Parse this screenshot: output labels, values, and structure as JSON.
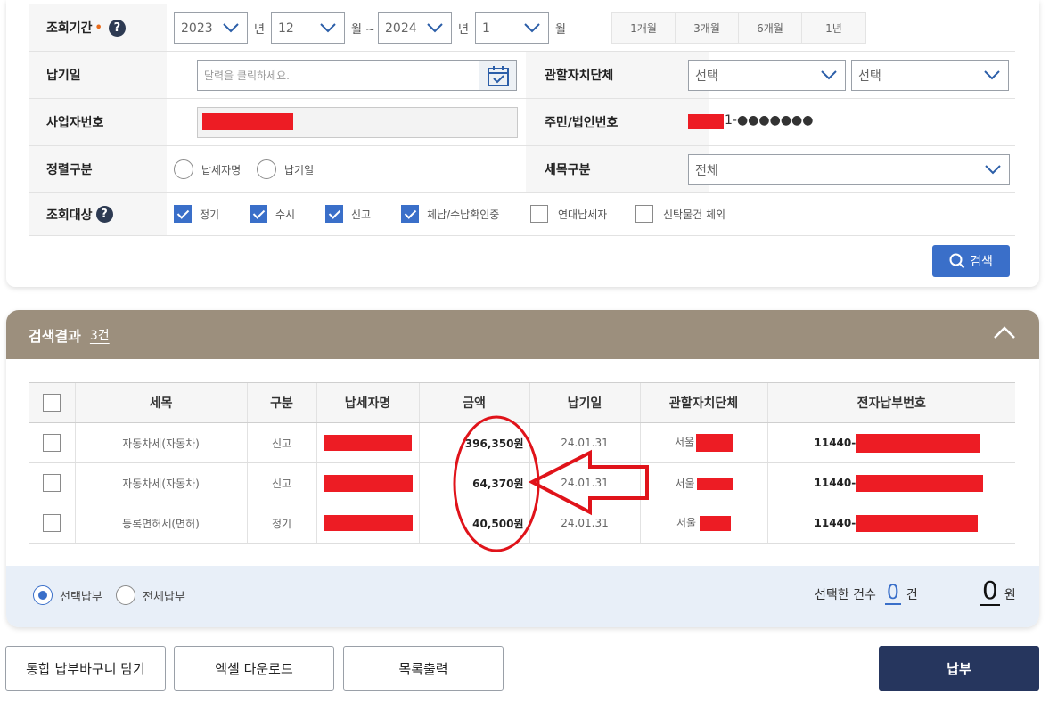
{
  "form": {
    "period": {
      "label": "조회기간",
      "required_mark": "•",
      "help": "?",
      "from_year": "2023",
      "year_unit": "년",
      "from_month": "12",
      "month_sep": "월 ~",
      "to_year": "2024",
      "to_month": "1",
      "month_unit": "월",
      "quick_buttons": [
        "1개월",
        "3개월",
        "6개월",
        "1년"
      ]
    },
    "due_date": {
      "label": "납기일",
      "placeholder": "달력을 클릭하세요."
    },
    "jurisdiction": {
      "label": "관할자치단체",
      "select1": "선택",
      "select2": "선택"
    },
    "business_no": {
      "label": "사업자번호"
    },
    "resident_no": {
      "label": "주민/법인번호",
      "masked_suffix": "1-●●●●●●●"
    },
    "sort": {
      "label": "정렬구분",
      "options": [
        "납세자명",
        "납기일"
      ]
    },
    "tax_type": {
      "label": "세목구분",
      "value": "전체"
    },
    "target": {
      "label": "조회대상",
      "help": "?",
      "options": [
        {
          "label": "정기",
          "checked": true
        },
        {
          "label": "수시",
          "checked": true
        },
        {
          "label": "신고",
          "checked": true
        },
        {
          "label": "체납/수납확인중",
          "checked": true
        },
        {
          "label": "연대납세자",
          "checked": false
        },
        {
          "label": "신탁물건 체외",
          "checked": false
        }
      ]
    },
    "search_button": "검색"
  },
  "results": {
    "title": "검색결과",
    "count": "3건",
    "columns": [
      "세목",
      "구분",
      "납세자명",
      "금액",
      "납기일",
      "관할자치단체",
      "전자납부번호"
    ],
    "rows": [
      {
        "tax": "자동차세(자동차)",
        "type": "신고",
        "amount": "396,350원",
        "due": "24.01.31",
        "region": "서울",
        "epay_prefix": "11440-"
      },
      {
        "tax": "자동차세(자동차)",
        "type": "신고",
        "amount": "64,370원",
        "due": "24.01.31",
        "region": "서울",
        "epay_prefix": "11440-"
      },
      {
        "tax": "등록면허세(면허)",
        "type": "정기",
        "amount": "40,500원",
        "due": "24.01.31",
        "region": "서울",
        "epay_prefix": "11440-"
      }
    ],
    "pay_mode": {
      "selected": "선택납부",
      "all": "전체납부"
    },
    "selected_count_label": "선택한 건수",
    "selected_count": "0",
    "count_unit": "건",
    "selected_amount": "0",
    "amount_unit": "원"
  },
  "actions": {
    "cart": "통합 납부바구니 담기",
    "excel": "엑셀 다운로드",
    "print": "목록출력",
    "pay": "납부"
  },
  "colors": {
    "accent": "#3a6fc9",
    "header_bg": "#9c8f7d",
    "pay_button": "#26365e",
    "redaction": "#ed1c24",
    "annotation": "#e0131a"
  }
}
